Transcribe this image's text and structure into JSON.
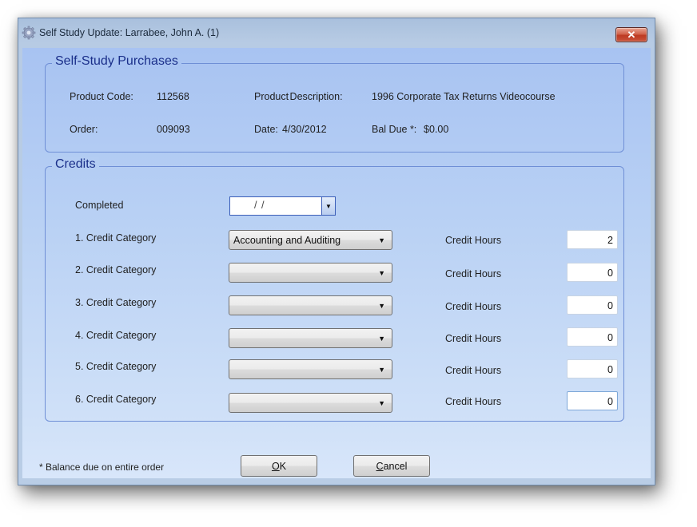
{
  "window": {
    "title": "Self Study Update: Larrabee, John A. (1)",
    "close_icon": "close-icon",
    "app_icon": "gear-icon"
  },
  "purchases": {
    "legend": "Self-Study Purchases",
    "product_code_label": "Product Code:",
    "product_code": "112568",
    "product_description_label": "Product Description:",
    "product_description": "1996 Corporate Tax Returns Videocourse",
    "order_label": "Order:",
    "order": "009093",
    "date_label": "Date:",
    "date": "4/30/2012",
    "bal_due_label": "Bal Due *:",
    "bal_due": "$0.00"
  },
  "credits": {
    "legend": "Credits",
    "completed_label": "Completed",
    "completed_value": "/     /",
    "hours_label": "Credit Hours",
    "rows": [
      {
        "label": "1. Credit Category",
        "category": "Accounting and Auditing",
        "hours": "2"
      },
      {
        "label": "2. Credit Category",
        "category": "",
        "hours": "0"
      },
      {
        "label": "3. Credit Category",
        "category": "",
        "hours": "0"
      },
      {
        "label": "4. Credit Category",
        "category": "",
        "hours": "0"
      },
      {
        "label": "5. Credit Category",
        "category": "",
        "hours": "0"
      },
      {
        "label": "6. Credit Category",
        "category": "",
        "hours": "0"
      }
    ]
  },
  "footer": {
    "note": "* Balance due on entire order",
    "ok_mnemonic": "O",
    "ok_rest": "K",
    "cancel_mnemonic": "C",
    "cancel_rest": "ancel"
  }
}
